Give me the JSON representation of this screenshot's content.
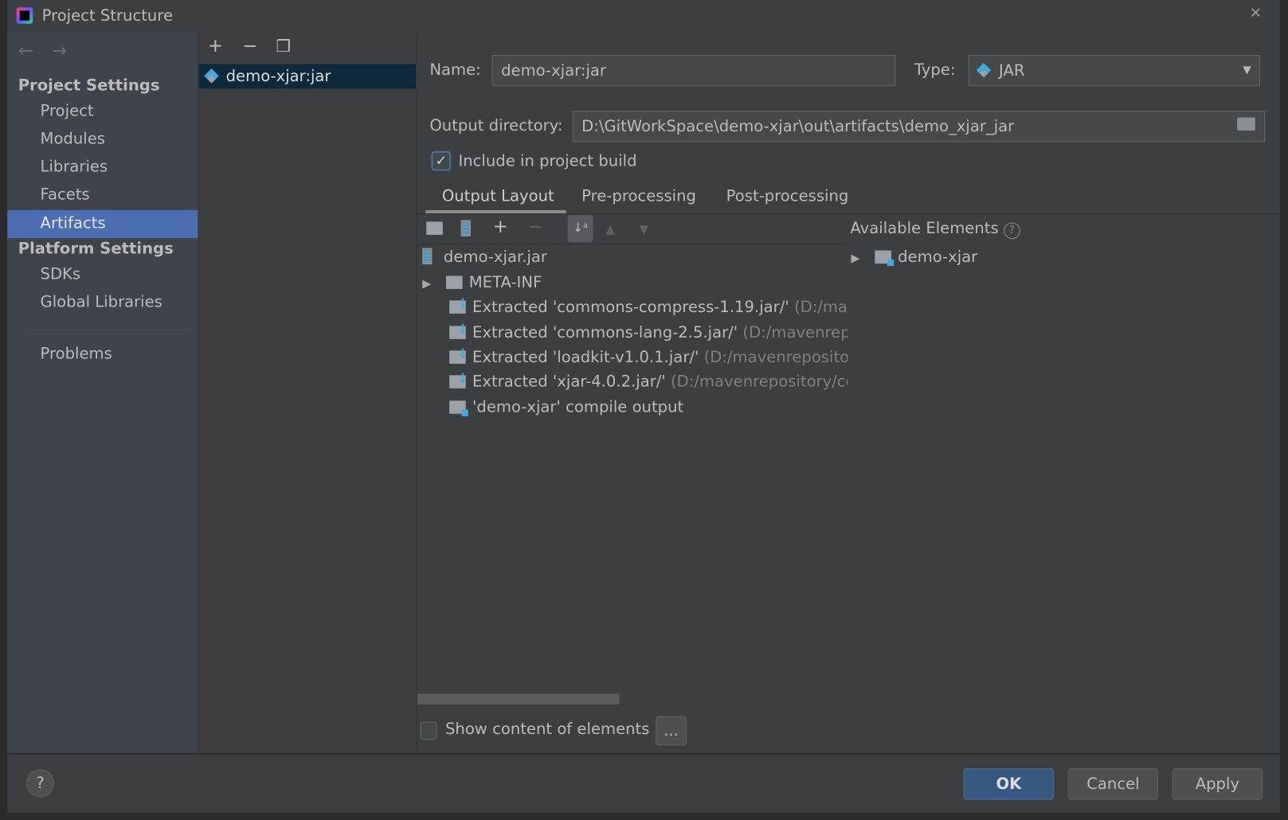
{
  "window": {
    "title": "Project Structure",
    "close_icon": "close-icon"
  },
  "sidebar": {
    "project_settings": "Project Settings",
    "items": [
      {
        "label": "Project"
      },
      {
        "label": "Modules"
      },
      {
        "label": "Libraries"
      },
      {
        "label": "Facets"
      },
      {
        "label": "Artifacts",
        "selected": true
      }
    ],
    "platform_settings": "Platform Settings",
    "platform_items": [
      {
        "label": "SDKs"
      },
      {
        "label": "Global Libraries"
      }
    ],
    "problems": "Problems"
  },
  "artifacts_list": {
    "items": [
      {
        "label": "demo-xjar:jar",
        "selected": true
      }
    ]
  },
  "form": {
    "name_label": "Name:",
    "name_value": "demo-xjar:jar",
    "type_label": "Type:",
    "type_value": "JAR",
    "output_dir_label": "Output directory:",
    "output_dir_value": "D:\\GitWorkSpace\\demo-xjar\\out\\artifacts\\demo_xjar_jar",
    "include_label": "Include in project build",
    "include_checked": true
  },
  "tabs": [
    {
      "label": "Output Layout",
      "active": true
    },
    {
      "label": "Pre-processing"
    },
    {
      "label": "Post-processing"
    }
  ],
  "layout_tree": {
    "root": "demo-xjar.jar",
    "items": [
      {
        "label": "META-INF",
        "dim": "",
        "expandable": true,
        "icon": "folder"
      },
      {
        "label": "Extracted 'commons-compress-1.19.jar/'",
        "dim": "(D:/mave",
        "icon": "extracted"
      },
      {
        "label": "Extracted 'commons-lang-2.5.jar/'",
        "dim": "(D:/mavenrepos",
        "icon": "extracted"
      },
      {
        "label": "Extracted 'loadkit-v1.0.1.jar/'",
        "dim": "(D:/mavenrepository,",
        "icon": "extracted"
      },
      {
        "label": "Extracted 'xjar-4.0.2.jar/'",
        "dim": "(D:/mavenrepository/com",
        "icon": "extracted"
      },
      {
        "label": "'demo-xjar' compile output",
        "dim": "",
        "icon": "module-output"
      }
    ]
  },
  "available": {
    "title": "Available Elements",
    "items": [
      {
        "label": "demo-xjar"
      }
    ]
  },
  "show_content": {
    "label": "Show content of elements",
    "checked": false,
    "more_label": "..."
  },
  "footer": {
    "help": "?",
    "ok": "OK",
    "cancel": "Cancel",
    "apply": "Apply"
  },
  "colors": {
    "accent": "#4b6eaf",
    "ok_button": "#365880",
    "selection": "#0d293e"
  }
}
